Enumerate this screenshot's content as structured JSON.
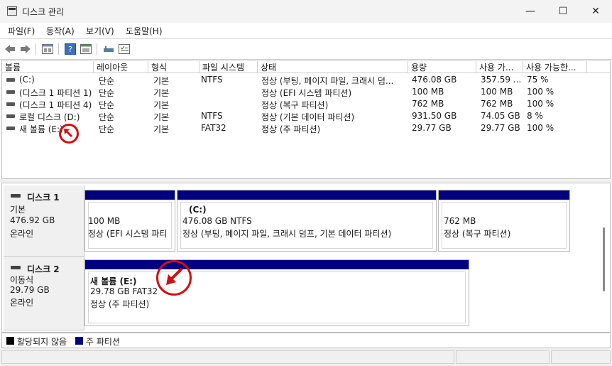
{
  "window": {
    "title": "디스크 관리",
    "minimize": "—",
    "maximize": "☐",
    "close": "✕"
  },
  "menu": [
    "파일(F)",
    "동작(A)",
    "보기(V)",
    "도움말(H)"
  ],
  "toolbar": {
    "icons": [
      "back-arrow-icon",
      "forward-arrow-icon",
      "properties-icon",
      "help-icon",
      "console-icon",
      "disk-view-icon",
      "checklist-icon"
    ]
  },
  "volume_table": {
    "columns": [
      "볼륨",
      "레이아웃",
      "형식",
      "파일 시스템",
      "상태",
      "용량",
      "사용 가...",
      "사용 가능한..."
    ],
    "rows": [
      {
        "volume": "(C:)",
        "layout": "단순",
        "type": "기본",
        "fs": "NTFS",
        "status": "정상 (부팅, 페이지 파일, 크래시 덤...",
        "capacity": "476.08 GB",
        "free": "357.59 ...",
        "pct": "75 %"
      },
      {
        "volume": "(디스크 1 파티션 1)",
        "layout": "단순",
        "type": "기본",
        "fs": "",
        "status": "정상 (EFI 시스템 파티션)",
        "capacity": "100 MB",
        "free": "100 MB",
        "pct": "100 %"
      },
      {
        "volume": "(디스크 1 파티션 4)",
        "layout": "단순",
        "type": "기본",
        "fs": "",
        "status": "정상 (복구 파티션)",
        "capacity": "762 MB",
        "free": "762 MB",
        "pct": "100 %"
      },
      {
        "volume": "로컬 디스크 (D:)",
        "layout": "단순",
        "type": "기본",
        "fs": "NTFS",
        "status": "정상 (기본 데이터 파티션)",
        "capacity": "931.50 GB",
        "free": "74.05 GB",
        "pct": "8 %"
      },
      {
        "volume": "새 볼륨 (E:)",
        "layout": "단순",
        "type": "기본",
        "fs": "FAT32",
        "status": "정상 (주 파티션)",
        "capacity": "29.77 GB",
        "free": "29.77 GB",
        "pct": "100 %"
      }
    ]
  },
  "disks": [
    {
      "name": "디스크 1",
      "kind": "기본",
      "size": "476.92 GB",
      "state": "온라인",
      "partitions": [
        {
          "title": "",
          "line1": "100 MB",
          "line2": "정상 (EFI 시스템 파티"
        },
        {
          "title": "(C:)",
          "line1": "476.08 GB NTFS",
          "line2": "정상 (부팅, 페이지 파일, 크래시 덤프, 기본 데이터 파티션)"
        },
        {
          "title": "",
          "line1": "762 MB",
          "line2": "정상 (복구 파티션)"
        }
      ]
    },
    {
      "name": "디스크 2",
      "kind": "이동식",
      "size": "29.79 GB",
      "state": "온라인",
      "partitions": [
        {
          "title": "새 볼륨  (E:)",
          "line1": "29.78 GB FAT32",
          "line2": "정상 (주 파티션)"
        }
      ]
    }
  ],
  "legend": [
    {
      "label": "할당되지 않음",
      "color": "#000000"
    },
    {
      "label": "주 파티션",
      "color": "#000080"
    }
  ],
  "colors": {
    "primary_partition": "#000080",
    "annotation": "#d01010"
  }
}
